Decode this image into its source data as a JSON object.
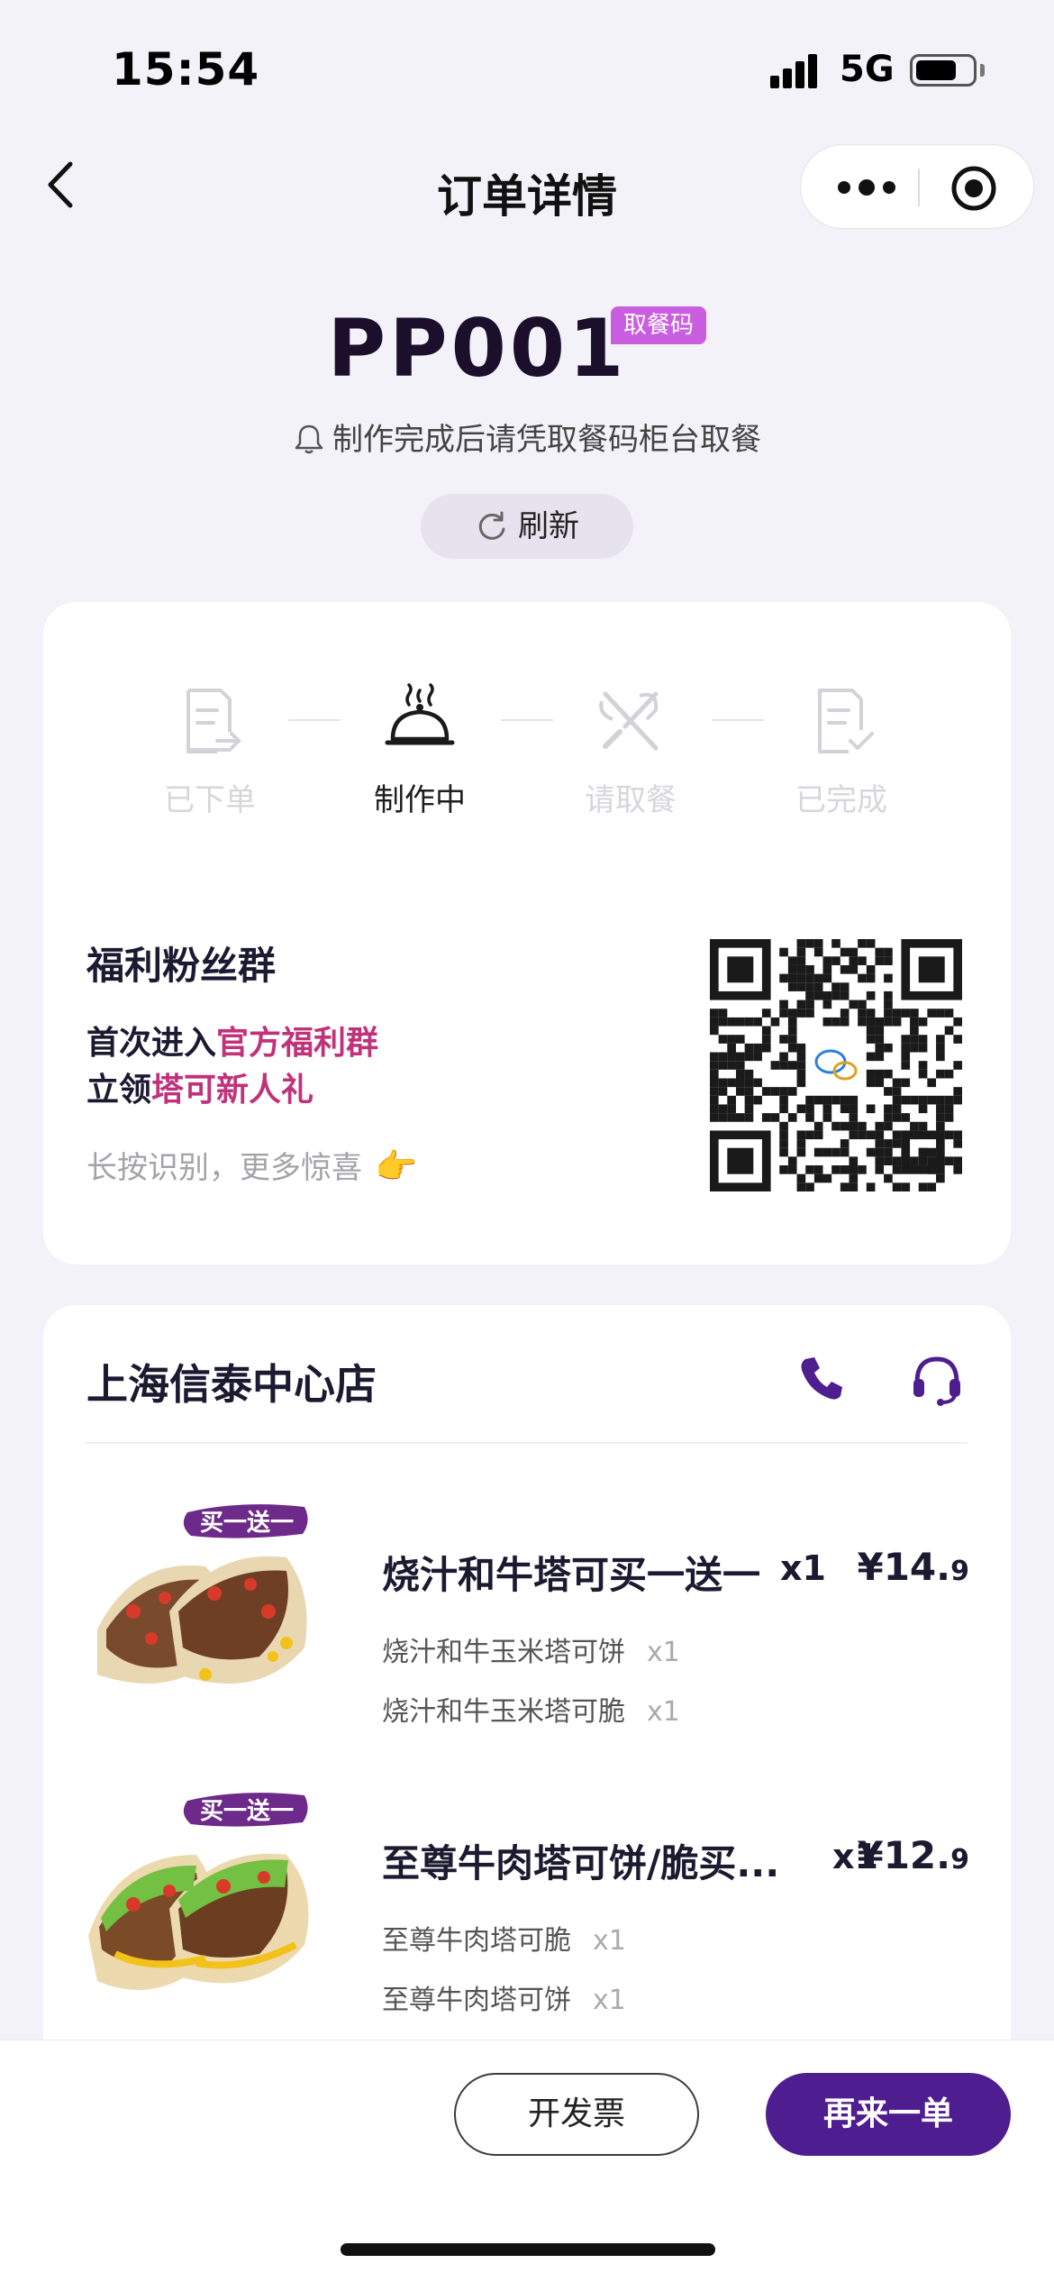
{
  "status_bar": {
    "time": "15:54",
    "network": "5G"
  },
  "nav": {
    "title": "订单详情"
  },
  "pickup": {
    "code": "PP001",
    "tag": "取餐码",
    "hint": "制作完成后请凭取餐码柜台取餐",
    "refresh_label": "刷新"
  },
  "progress": {
    "steps": [
      {
        "label": "已下单",
        "icon": "order-doc-icon",
        "active": false
      },
      {
        "label": "制作中",
        "icon": "cloche-icon",
        "active": true
      },
      {
        "label": "请取餐",
        "icon": "utensils-icon",
        "active": false
      },
      {
        "label": "已完成",
        "icon": "doc-check-icon",
        "active": false
      }
    ]
  },
  "fan_group": {
    "title": "福利粉丝群",
    "line1_prefix": "首次进入",
    "line1_highlight": "官方福利群",
    "line2_prefix": "立领",
    "line2_highlight": "塔可新人礼",
    "tip": "长按识别，更多惊喜",
    "tip_icon": "👉"
  },
  "store": {
    "name": "上海信泰中心店",
    "items": [
      {
        "badge": "买一送一",
        "name": "烧汁和牛塔可买一送一",
        "qty": "x1",
        "price_main": "¥14.",
        "price_dec": "9",
        "subitems": [
          {
            "name": "烧汁和牛玉米塔可饼",
            "qty": "x1"
          },
          {
            "name": "烧汁和牛玉米塔可脆",
            "qty": "x1"
          }
        ]
      },
      {
        "badge": "买一送一",
        "name": "至尊牛肉塔可饼/脆买...",
        "qty": "x1",
        "price_main": "¥12.",
        "price_dec": "9",
        "subitems": [
          {
            "name": "至尊牛肉塔可脆",
            "qty": "x1"
          },
          {
            "name": "至尊牛肉塔可饼",
            "qty": "x1"
          }
        ]
      }
    ]
  },
  "actions": {
    "invoice_label": "开发票",
    "reorder_label": "再来一单"
  },
  "colors": {
    "brand": "#4e1d8f",
    "highlight": "#c0327a",
    "tag": "#c95ee0"
  }
}
